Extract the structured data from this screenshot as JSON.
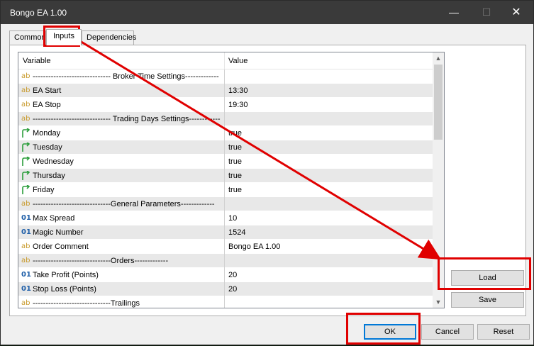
{
  "window": {
    "title": "Bongo EA 1.00"
  },
  "tabs": [
    {
      "label": "Common"
    },
    {
      "label": "Inputs"
    },
    {
      "label": "Dependencies"
    }
  ],
  "grid": {
    "headers": {
      "variable": "Variable",
      "value": "Value"
    },
    "rows": [
      {
        "icon": "ab",
        "name": "------------------------------ Broker Time Settings-------------",
        "value": ""
      },
      {
        "icon": "ab",
        "name": "EA Start",
        "value": "13:30"
      },
      {
        "icon": "ab",
        "name": "EA Stop",
        "value": "19:30"
      },
      {
        "icon": "ab",
        "name": "------------------------------ Trading Days Settings------------",
        "value": ""
      },
      {
        "icon": "bool",
        "name": "Monday",
        "value": "true"
      },
      {
        "icon": "bool",
        "name": "Tuesday",
        "value": "true"
      },
      {
        "icon": "bool",
        "name": "Wednesday",
        "value": "true"
      },
      {
        "icon": "bool",
        "name": "Thursday",
        "value": "true"
      },
      {
        "icon": "bool",
        "name": "Friday",
        "value": "true"
      },
      {
        "icon": "ab",
        "name": "------------------------------General Parameters-------------",
        "value": ""
      },
      {
        "icon": "01",
        "name": "Max Spread",
        "value": "10"
      },
      {
        "icon": "01",
        "name": "Magic Number",
        "value": "1524"
      },
      {
        "icon": "ab",
        "name": "Order Comment",
        "value": "Bongo EA 1.00"
      },
      {
        "icon": "ab",
        "name": "------------------------------Orders-------------",
        "value": ""
      },
      {
        "icon": "01",
        "name": "Take Profit (Points)",
        "value": "20"
      },
      {
        "icon": "01",
        "name": "Stop Loss (Points)",
        "value": "20"
      },
      {
        "icon": "ab",
        "name": "------------------------------Trailings",
        "value": ""
      }
    ]
  },
  "buttons": {
    "load": "Load",
    "save": "Save",
    "ok": "OK",
    "cancel": "Cancel",
    "reset": "Reset"
  },
  "colors": {
    "annotation": "#e00000",
    "titlebar": "#3a3a3a",
    "focus": "#0078d7"
  }
}
